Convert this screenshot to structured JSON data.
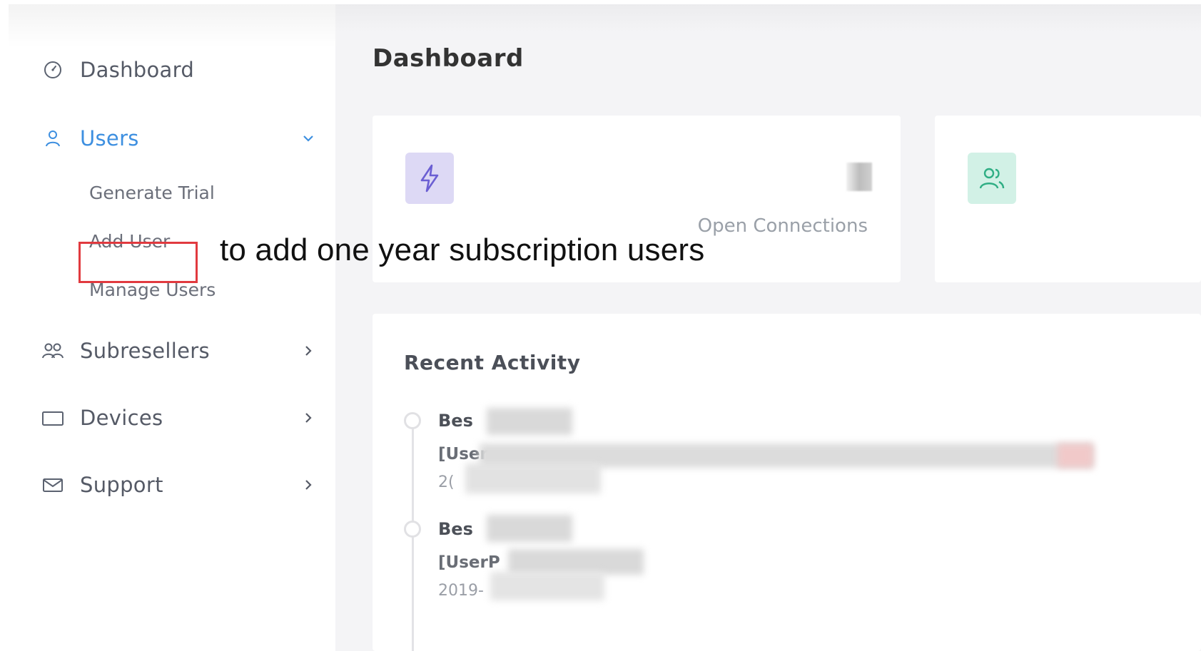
{
  "sidebar": {
    "items": [
      {
        "label": "Dashboard",
        "icon": "gauge-icon"
      },
      {
        "label": "Users",
        "icon": "user-icon",
        "active": true,
        "chevron": "chevron-down-icon",
        "subitems": [
          "Generate Trial",
          "Add User",
          "Manage Users"
        ]
      },
      {
        "label": "Subresellers",
        "icon": "users-icon",
        "chevron": "chevron-right-icon"
      },
      {
        "label": "Devices",
        "icon": "monitor-icon",
        "chevron": "chevron-right-icon"
      },
      {
        "label": "Support",
        "icon": "mail-icon",
        "chevron": "chevron-right-icon"
      }
    ]
  },
  "main": {
    "title": "Dashboard",
    "stat_cards": [
      {
        "icon": "bolt-icon",
        "label": "Open Connections"
      },
      {
        "icon": "users-icon"
      }
    ],
    "activity": {
      "title": "Recent Activity",
      "entries": [
        {
          "head": "Bes",
          "sub": "[User",
          "date": "2("
        },
        {
          "head": "Bes",
          "sub": "[UserP",
          "date": "2019-"
        }
      ]
    }
  },
  "annotation": {
    "text": "to add one year subscription users",
    "highlight_color": "#e13a3f"
  },
  "colors": {
    "accent": "#3d8fe0",
    "purple_tile": "#ddd9f5",
    "green_tile": "#d2f1e6"
  }
}
